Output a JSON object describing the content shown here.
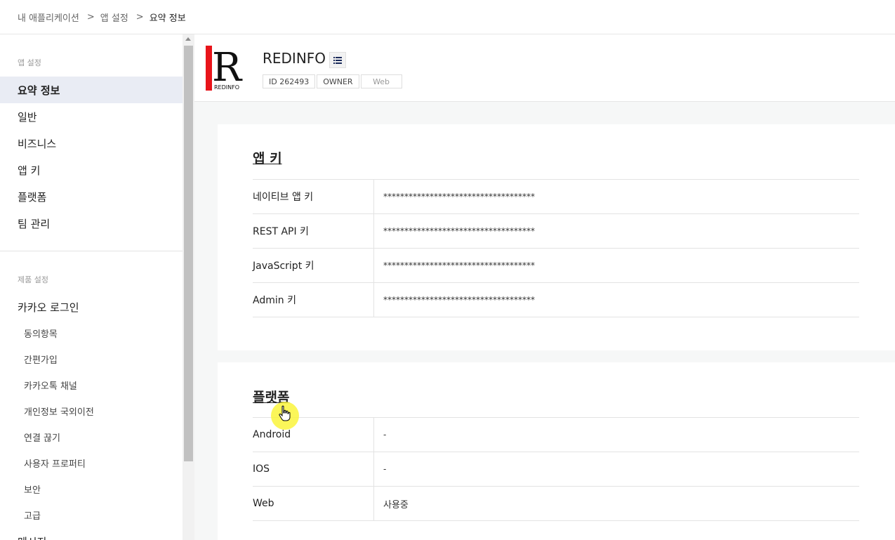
{
  "breadcrumb": {
    "items": [
      "내 애플리케이션",
      "앱 설정",
      "요약 정보"
    ],
    "separator": ">"
  },
  "sidebar": {
    "section_app": "앱 설정",
    "app_items": [
      "요약 정보",
      "일반",
      "비즈니스",
      "앱 키",
      "플랫폼",
      "팀 관리"
    ],
    "active_item": "요약 정보",
    "section_product": "제품 설정",
    "product_group": "카카오 로그인",
    "product_subitems": [
      "동의항목",
      "간편가입",
      "카카오톡 채널",
      "개인정보 국외이전",
      "연결 끊기",
      "사용자 프로퍼티",
      "보안",
      "고급"
    ],
    "next_item": "메시지"
  },
  "app": {
    "name": "REDINFO",
    "logo_letter": "R",
    "logo_text": "REDINFO",
    "tags": [
      "ID 262493",
      "OWNER",
      "Web"
    ],
    "menu_icon": "list-icon"
  },
  "app_keys": {
    "title": "앱 키",
    "rows": [
      {
        "label": "네이티브 앱 키",
        "value": "************************************"
      },
      {
        "label": "REST API 키",
        "value": "************************************"
      },
      {
        "label": "JavaScript 키",
        "value": "************************************"
      },
      {
        "label": "Admin 키",
        "value": "************************************"
      }
    ]
  },
  "platform": {
    "title": "플랫폼",
    "rows": [
      {
        "label": "Android",
        "value": "-"
      },
      {
        "label": "IOS",
        "value": "-"
      },
      {
        "label": "Web",
        "value": "사용중"
      }
    ]
  },
  "colors": {
    "logo_red": "#e8141a",
    "active_bg": "#e9ecf4",
    "cursor_highlight": "#faf53c"
  }
}
